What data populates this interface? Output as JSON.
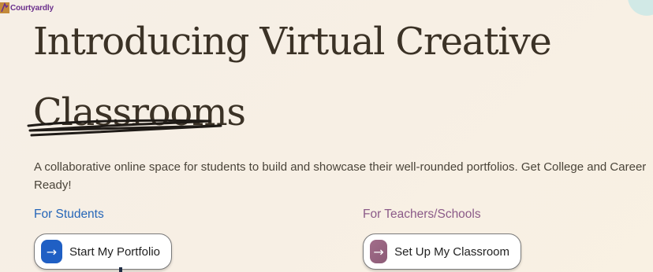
{
  "brand": {
    "name": "Courtyardly",
    "icon": "courtyardly-logo-icon"
  },
  "hero": {
    "title": "Introducing Virtual Creative Classrooms",
    "subtitle": "A collaborative online space for students to build and showcase their well-rounded portfolios. Get College and Career Ready!"
  },
  "students": {
    "label": "For Students",
    "button_label": "Start My Portfolio",
    "icon": "arrow-right-icon"
  },
  "teachers": {
    "label": "For Teachers/Schools",
    "button_label": "Set Up My Classroom",
    "icon": "arrow-right-icon"
  },
  "colors": {
    "background": "#f7efe4",
    "title": "#3b3226",
    "students_accent": "#2566b8",
    "teachers_accent": "#8b5a88"
  }
}
